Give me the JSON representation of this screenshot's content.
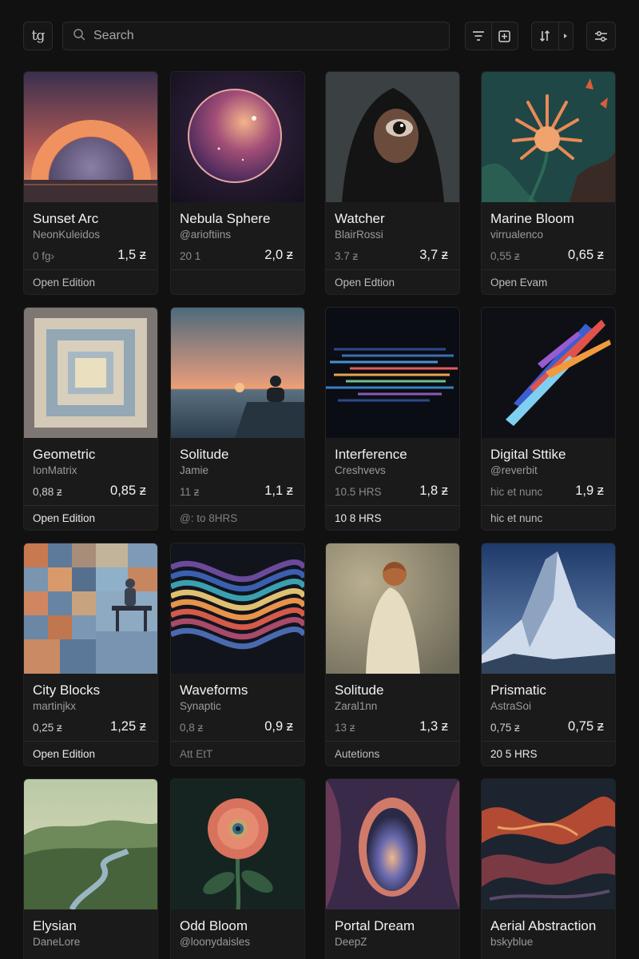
{
  "toolbar": {
    "logo": "tg",
    "search_placeholder": "Search"
  },
  "cards": [
    {
      "title": "Sunset Arc",
      "artist": "NeonKuleidos",
      "sub": "0 fg›",
      "price": "1,5 ƶ",
      "foot": "Open Edition"
    },
    {
      "title": "Nebula Sphere",
      "artist": "@arioftiins",
      "sub": "20 1",
      "price": "2,0 ƶ",
      "foot": ""
    },
    {
      "title": "Watcher",
      "artist": "BlairRossi",
      "sub": "3.7 ƶ",
      "price": "3,7 ƶ",
      "foot": "Open Edtion"
    },
    {
      "title": "Marine Bloom",
      "artist": "virrualenco",
      "sub": "0,55 ƶ",
      "price": "0,65 ƶ",
      "foot": "Open Evam"
    },
    {
      "title": "Geometric",
      "artist": "IonMatrix",
      "sub": "0,88 ƶ",
      "price": "0,85 ƶ",
      "foot": "Open Edition"
    },
    {
      "title": "Solitude",
      "artist": "Jamie",
      "sub": "11 ƶ",
      "price": "1,1 ƶ",
      "foot": "@: to 8HRS"
    },
    {
      "title": "Interference",
      "artist": "Creshvevs",
      "sub": "10.5 HRS",
      "price": "1,8 ƶ",
      "foot": "10 8 HRS"
    },
    {
      "title": "Digital Sttike",
      "artist": "@reverbit",
      "sub": "hic et nunc",
      "price": "1,9 ƶ",
      "foot": "hic et nunc"
    },
    {
      "title": "City Blocks",
      "artist": "martinjkx",
      "sub": "0,25 ƶ",
      "price": "1,25 ƶ",
      "foot": "Open Edition"
    },
    {
      "title": "Waveforms",
      "artist": "Synaptic",
      "sub": "0,8 ƶ",
      "price": "0,9 ƶ",
      "foot": "Att EtT"
    },
    {
      "title": "Solitude",
      "artist": "Zaral1nn",
      "sub": "13 ƶ",
      "price": "1,3 ƶ",
      "foot": "Autetions"
    },
    {
      "title": "Prismatic",
      "artist": "AstraSoi",
      "sub": "0,75 ƶ",
      "price": "0,75 ƶ",
      "foot": "20 5 HRS"
    },
    {
      "title": "Elysian",
      "artist": "DaneLore",
      "sub": "",
      "price": "",
      "foot": ""
    },
    {
      "title": "Odd Bloom",
      "artist": "@loonydaisles",
      "sub": "",
      "price": "",
      "foot": ""
    },
    {
      "title": "Portal Dream",
      "artist": "DeepZ",
      "sub": "",
      "price": "",
      "foot": ""
    },
    {
      "title": "Aerial Abstraction",
      "artist": "bskyblue",
      "sub": "",
      "price": "",
      "foot": ""
    }
  ]
}
